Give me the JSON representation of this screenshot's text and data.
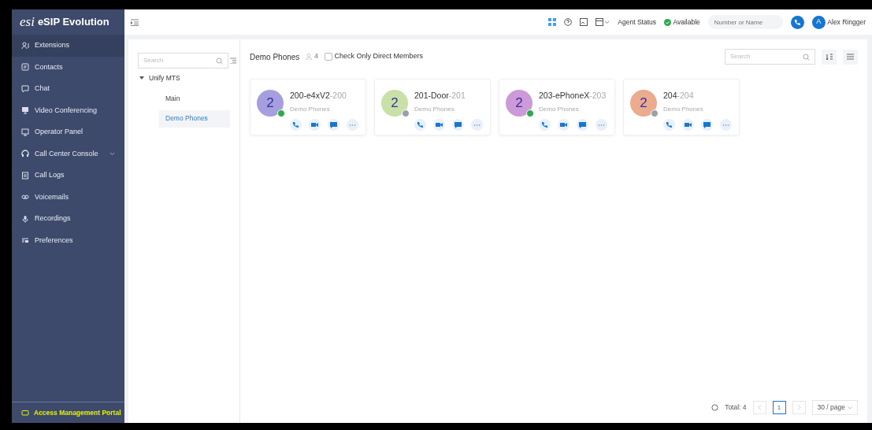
{
  "app": {
    "logo_mark": "esi",
    "title": "eSIP Evolution"
  },
  "sidebar": {
    "items": [
      {
        "label": "Extensions",
        "selected": true,
        "has_submenu": false
      },
      {
        "label": "Contacts",
        "selected": false,
        "has_submenu": false
      },
      {
        "label": "Chat",
        "selected": false,
        "has_submenu": false
      },
      {
        "label": "Video Conferencing",
        "selected": false,
        "has_submenu": false
      },
      {
        "label": "Operator Panel",
        "selected": false,
        "has_submenu": false
      },
      {
        "label": "Call Center Console",
        "selected": false,
        "has_submenu": true
      },
      {
        "label": "Call Logs",
        "selected": false,
        "has_submenu": false
      },
      {
        "label": "Voicemails",
        "selected": false,
        "has_submenu": false
      },
      {
        "label": "Recordings",
        "selected": false,
        "has_submenu": false
      },
      {
        "label": "Preferences",
        "selected": false,
        "has_submenu": false
      }
    ],
    "footer_link": "Access Management Portal"
  },
  "header": {
    "agent_status": "Agent Status",
    "presence": "Available",
    "dial_placeholder": "Number or Name",
    "user_initial": "A",
    "user_name": "Alex Ringger"
  },
  "tree": {
    "search_placeholder": "Search",
    "root": {
      "label": "Unify MTS",
      "expanded": true,
      "children": [
        {
          "label": "Main",
          "selected": false
        },
        {
          "label": "Demo Phones",
          "selected": true
        }
      ]
    }
  },
  "group": {
    "title": "Demo Phones",
    "member_count": "4",
    "direct_only_label": "Check Only Direct Members",
    "direct_only_checked": false,
    "search_placeholder": "Search"
  },
  "extensions": [
    {
      "name": "200-e4xV2",
      "number": "-200",
      "group": "Demo Phones",
      "initial": "2",
      "color": "#a59fe0",
      "online": true
    },
    {
      "name": "201-Door",
      "number": "-201",
      "group": "Demo Phones",
      "initial": "2",
      "color": "#c9e0a8",
      "online": false
    },
    {
      "name": "203-ePhoneX",
      "number": "-203",
      "group": "Demo Phones",
      "initial": "2",
      "color": "#cc99d9",
      "online": true
    },
    {
      "name": "204",
      "number": "-204",
      "group": "Demo Phones",
      "initial": "2",
      "color": "#ebab8f",
      "online": false
    }
  ],
  "pagination": {
    "total": "Total: 4",
    "pages": [
      {
        "label": "1",
        "selected": true
      }
    ],
    "page_size": "30 / page"
  }
}
